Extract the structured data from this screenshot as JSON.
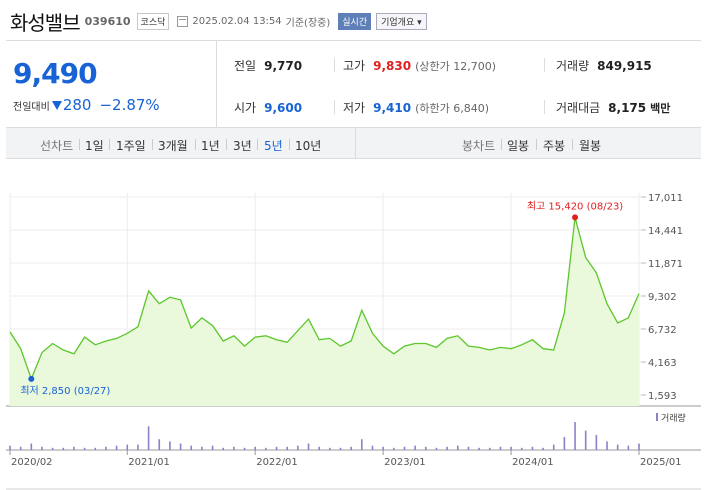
{
  "header": {
    "name": "화성밸브",
    "code": "039610",
    "market": "코스닥",
    "datetime": "2025.02.04 13:54",
    "basis": "기준(장중)",
    "realtime": "실시간",
    "corp_info": "기업개요"
  },
  "quote": {
    "price": "9,490",
    "change_label": "전일대비",
    "change_value": "280",
    "change_pct": "−2.87%",
    "direction": "down"
  },
  "stats": {
    "prev_label": "전일",
    "prev": "9,770",
    "high_label": "고가",
    "high": "9,830",
    "upper_limit": "(상한가 12,700)",
    "volume_label": "거래량",
    "volume": "849,915",
    "open_label": "시가",
    "open": "9,600",
    "low_label": "저가",
    "low": "9,410",
    "lower_limit": "(하한가 6,840)",
    "amount_label": "거래대금",
    "amount": "8,175",
    "amount_unit": "백만"
  },
  "tabs": {
    "line_label": "선차트",
    "line_periods": [
      "1일",
      "1주일",
      "3개월",
      "1년",
      "3년",
      "5년",
      "10년"
    ],
    "active_period": "5년",
    "candle_label": "봉차트",
    "candle_periods": [
      "일봉",
      "주봉",
      "월봉"
    ]
  },
  "colors": {
    "price_down": "#1763d6",
    "price_up": "#e02020",
    "line": "#5cc62b",
    "fill": "#eaf9dc",
    "volume": "#8c80c8"
  },
  "chart_data": {
    "type": "area",
    "ylim": [
      1593,
      17011
    ],
    "y_ticks": [
      "17,011",
      "14,441",
      "11,871",
      "9,302",
      "6,732",
      "4,163",
      "1,593"
    ],
    "x_tick_labels": [
      "2020/02",
      "2021/01",
      "2022/01",
      "2023/01",
      "2024/01",
      "2025/01"
    ],
    "x_ticks": [
      0,
      11,
      23,
      35,
      47,
      59
    ],
    "series": [
      {
        "values": [
          6500,
          5200,
          2850,
          4900,
          5600,
          5100,
          4800,
          6100,
          5500,
          5800,
          6000,
          6400,
          6900,
          9700,
          8700,
          9200,
          9000,
          6800,
          7600,
          7000,
          5800,
          6200,
          5400,
          6100,
          6200,
          5900,
          5700,
          6600,
          7500,
          5900,
          6000,
          5400,
          5800,
          8200,
          6400,
          5400,
          4800,
          5400,
          5600,
          5600,
          5300,
          6000,
          6200,
          5400,
          5300,
          5100,
          5300,
          5200,
          5500,
          5900,
          5200,
          5100,
          8000,
          15420,
          12300,
          11100,
          8700,
          7200,
          7600,
          9490
        ]
      }
    ],
    "max_marker": {
      "index": 53,
      "label": "최고 15,420 (08/23)"
    },
    "min_marker": {
      "index": 2,
      "label": "최저 2,850 (03/27)"
    },
    "volume": {
      "label": "거래량",
      "values": [
        4,
        3,
        6,
        3,
        2,
        2,
        3,
        2,
        2,
        3,
        4,
        5,
        5,
        22,
        10,
        8,
        6,
        4,
        3,
        4,
        2,
        3,
        2,
        3,
        2,
        3,
        3,
        4,
        6,
        3,
        2,
        2,
        3,
        10,
        4,
        3,
        2,
        3,
        4,
        3,
        2,
        3,
        4,
        3,
        2,
        2,
        3,
        3,
        2,
        3,
        2,
        5,
        12,
        26,
        18,
        14,
        8,
        5,
        4,
        6
      ]
    }
  }
}
